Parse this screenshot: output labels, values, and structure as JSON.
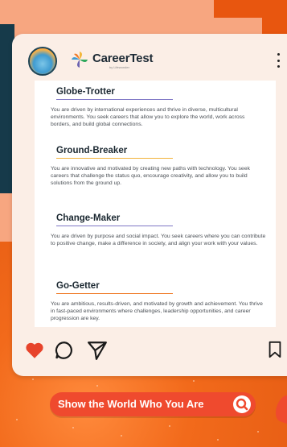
{
  "header": {
    "brand": "CareerTest",
    "brand_sub": "by Lifewonder",
    "icons": {
      "avatar": "avatar",
      "logo": "pinwheel-logo-icon",
      "menu": "more-vertical-icon"
    }
  },
  "colors": {
    "strip_green": "#2ea75c",
    "strip_yellow": "#f3b73c",
    "strip_purple": "#6b62b0",
    "strip_orange": "#f07b28",
    "heart": "#e7432b",
    "cta": "#ef4a2e"
  },
  "sections": [
    {
      "title": "Globe-Trotter",
      "rule_color": "#7f77c6",
      "body": "You are driven by international experiences and thrive in diverse, multicultural environments. You seek careers that allow you to explore the world, work across borders, and build global connections."
    },
    {
      "title": "Ground-Breaker",
      "rule_color": "#f2b23a",
      "body": "You are innovative and motivated by creating new paths with technology. You seek careers that challenge the status quo, encourage creativity, and allow you to build solutions from the ground up."
    },
    {
      "title": "Change-Maker",
      "rule_color": "#7f77c6",
      "body": "You are driven by purpose and social impact. You seek careers where you can contribute to positive change, make a difference in society, and align your work with your values."
    },
    {
      "title": "Go-Getter",
      "rule_color": "#f07b28",
      "body": "You are ambitious, results-driven, and motivated by growth and achievement. You thrive in fast-paced environments where challenges, leadership opportunities, and career progression are key."
    }
  ],
  "actions": {
    "like": "heart-icon",
    "comment": "comment-icon",
    "share": "send-icon",
    "save": "bookmark-icon"
  },
  "cta": {
    "label": "Show the World Who You Are",
    "icon": "search-icon"
  }
}
